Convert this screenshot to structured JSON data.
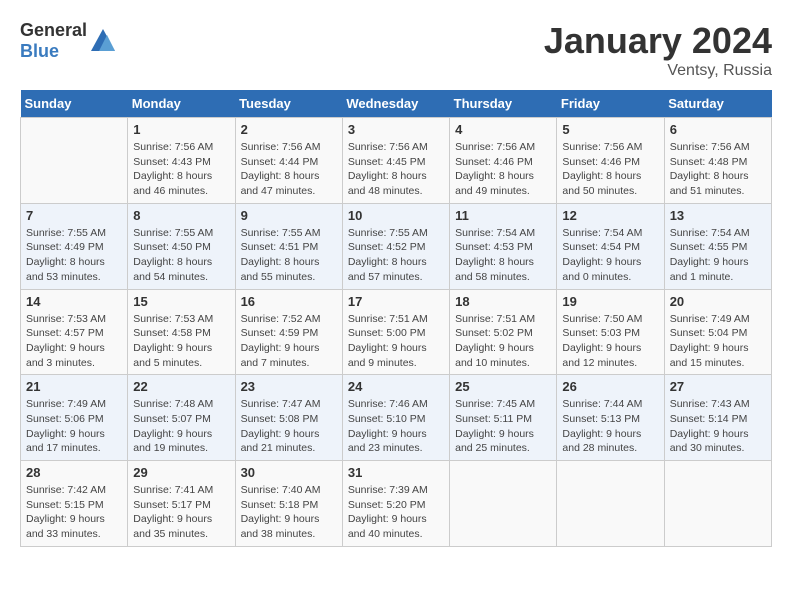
{
  "logo": {
    "text_general": "General",
    "text_blue": "Blue"
  },
  "header": {
    "month": "January 2024",
    "location": "Ventsy, Russia"
  },
  "weekdays": [
    "Sunday",
    "Monday",
    "Tuesday",
    "Wednesday",
    "Thursday",
    "Friday",
    "Saturday"
  ],
  "weeks": [
    [
      {
        "day": "",
        "info": ""
      },
      {
        "day": "1",
        "info": "Sunrise: 7:56 AM\nSunset: 4:43 PM\nDaylight: 8 hours\nand 46 minutes."
      },
      {
        "day": "2",
        "info": "Sunrise: 7:56 AM\nSunset: 4:44 PM\nDaylight: 8 hours\nand 47 minutes."
      },
      {
        "day": "3",
        "info": "Sunrise: 7:56 AM\nSunset: 4:45 PM\nDaylight: 8 hours\nand 48 minutes."
      },
      {
        "day": "4",
        "info": "Sunrise: 7:56 AM\nSunset: 4:46 PM\nDaylight: 8 hours\nand 49 minutes."
      },
      {
        "day": "5",
        "info": "Sunrise: 7:56 AM\nSunset: 4:46 PM\nDaylight: 8 hours\nand 50 minutes."
      },
      {
        "day": "6",
        "info": "Sunrise: 7:56 AM\nSunset: 4:48 PM\nDaylight: 8 hours\nand 51 minutes."
      }
    ],
    [
      {
        "day": "7",
        "info": "Sunrise: 7:55 AM\nSunset: 4:49 PM\nDaylight: 8 hours\nand 53 minutes."
      },
      {
        "day": "8",
        "info": "Sunrise: 7:55 AM\nSunset: 4:50 PM\nDaylight: 8 hours\nand 54 minutes."
      },
      {
        "day": "9",
        "info": "Sunrise: 7:55 AM\nSunset: 4:51 PM\nDaylight: 8 hours\nand 55 minutes."
      },
      {
        "day": "10",
        "info": "Sunrise: 7:55 AM\nSunset: 4:52 PM\nDaylight: 8 hours\nand 57 minutes."
      },
      {
        "day": "11",
        "info": "Sunrise: 7:54 AM\nSunset: 4:53 PM\nDaylight: 8 hours\nand 58 minutes."
      },
      {
        "day": "12",
        "info": "Sunrise: 7:54 AM\nSunset: 4:54 PM\nDaylight: 9 hours\nand 0 minutes."
      },
      {
        "day": "13",
        "info": "Sunrise: 7:54 AM\nSunset: 4:55 PM\nDaylight: 9 hours\nand 1 minute."
      }
    ],
    [
      {
        "day": "14",
        "info": "Sunrise: 7:53 AM\nSunset: 4:57 PM\nDaylight: 9 hours\nand 3 minutes."
      },
      {
        "day": "15",
        "info": "Sunrise: 7:53 AM\nSunset: 4:58 PM\nDaylight: 9 hours\nand 5 minutes."
      },
      {
        "day": "16",
        "info": "Sunrise: 7:52 AM\nSunset: 4:59 PM\nDaylight: 9 hours\nand 7 minutes."
      },
      {
        "day": "17",
        "info": "Sunrise: 7:51 AM\nSunset: 5:00 PM\nDaylight: 9 hours\nand 9 minutes."
      },
      {
        "day": "18",
        "info": "Sunrise: 7:51 AM\nSunset: 5:02 PM\nDaylight: 9 hours\nand 10 minutes."
      },
      {
        "day": "19",
        "info": "Sunrise: 7:50 AM\nSunset: 5:03 PM\nDaylight: 9 hours\nand 12 minutes."
      },
      {
        "day": "20",
        "info": "Sunrise: 7:49 AM\nSunset: 5:04 PM\nDaylight: 9 hours\nand 15 minutes."
      }
    ],
    [
      {
        "day": "21",
        "info": "Sunrise: 7:49 AM\nSunset: 5:06 PM\nDaylight: 9 hours\nand 17 minutes."
      },
      {
        "day": "22",
        "info": "Sunrise: 7:48 AM\nSunset: 5:07 PM\nDaylight: 9 hours\nand 19 minutes."
      },
      {
        "day": "23",
        "info": "Sunrise: 7:47 AM\nSunset: 5:08 PM\nDaylight: 9 hours\nand 21 minutes."
      },
      {
        "day": "24",
        "info": "Sunrise: 7:46 AM\nSunset: 5:10 PM\nDaylight: 9 hours\nand 23 minutes."
      },
      {
        "day": "25",
        "info": "Sunrise: 7:45 AM\nSunset: 5:11 PM\nDaylight: 9 hours\nand 25 minutes."
      },
      {
        "day": "26",
        "info": "Sunrise: 7:44 AM\nSunset: 5:13 PM\nDaylight: 9 hours\nand 28 minutes."
      },
      {
        "day": "27",
        "info": "Sunrise: 7:43 AM\nSunset: 5:14 PM\nDaylight: 9 hours\nand 30 minutes."
      }
    ],
    [
      {
        "day": "28",
        "info": "Sunrise: 7:42 AM\nSunset: 5:15 PM\nDaylight: 9 hours\nand 33 minutes."
      },
      {
        "day": "29",
        "info": "Sunrise: 7:41 AM\nSunset: 5:17 PM\nDaylight: 9 hours\nand 35 minutes."
      },
      {
        "day": "30",
        "info": "Sunrise: 7:40 AM\nSunset: 5:18 PM\nDaylight: 9 hours\nand 38 minutes."
      },
      {
        "day": "31",
        "info": "Sunrise: 7:39 AM\nSunset: 5:20 PM\nDaylight: 9 hours\nand 40 minutes."
      },
      {
        "day": "",
        "info": ""
      },
      {
        "day": "",
        "info": ""
      },
      {
        "day": "",
        "info": ""
      }
    ]
  ]
}
